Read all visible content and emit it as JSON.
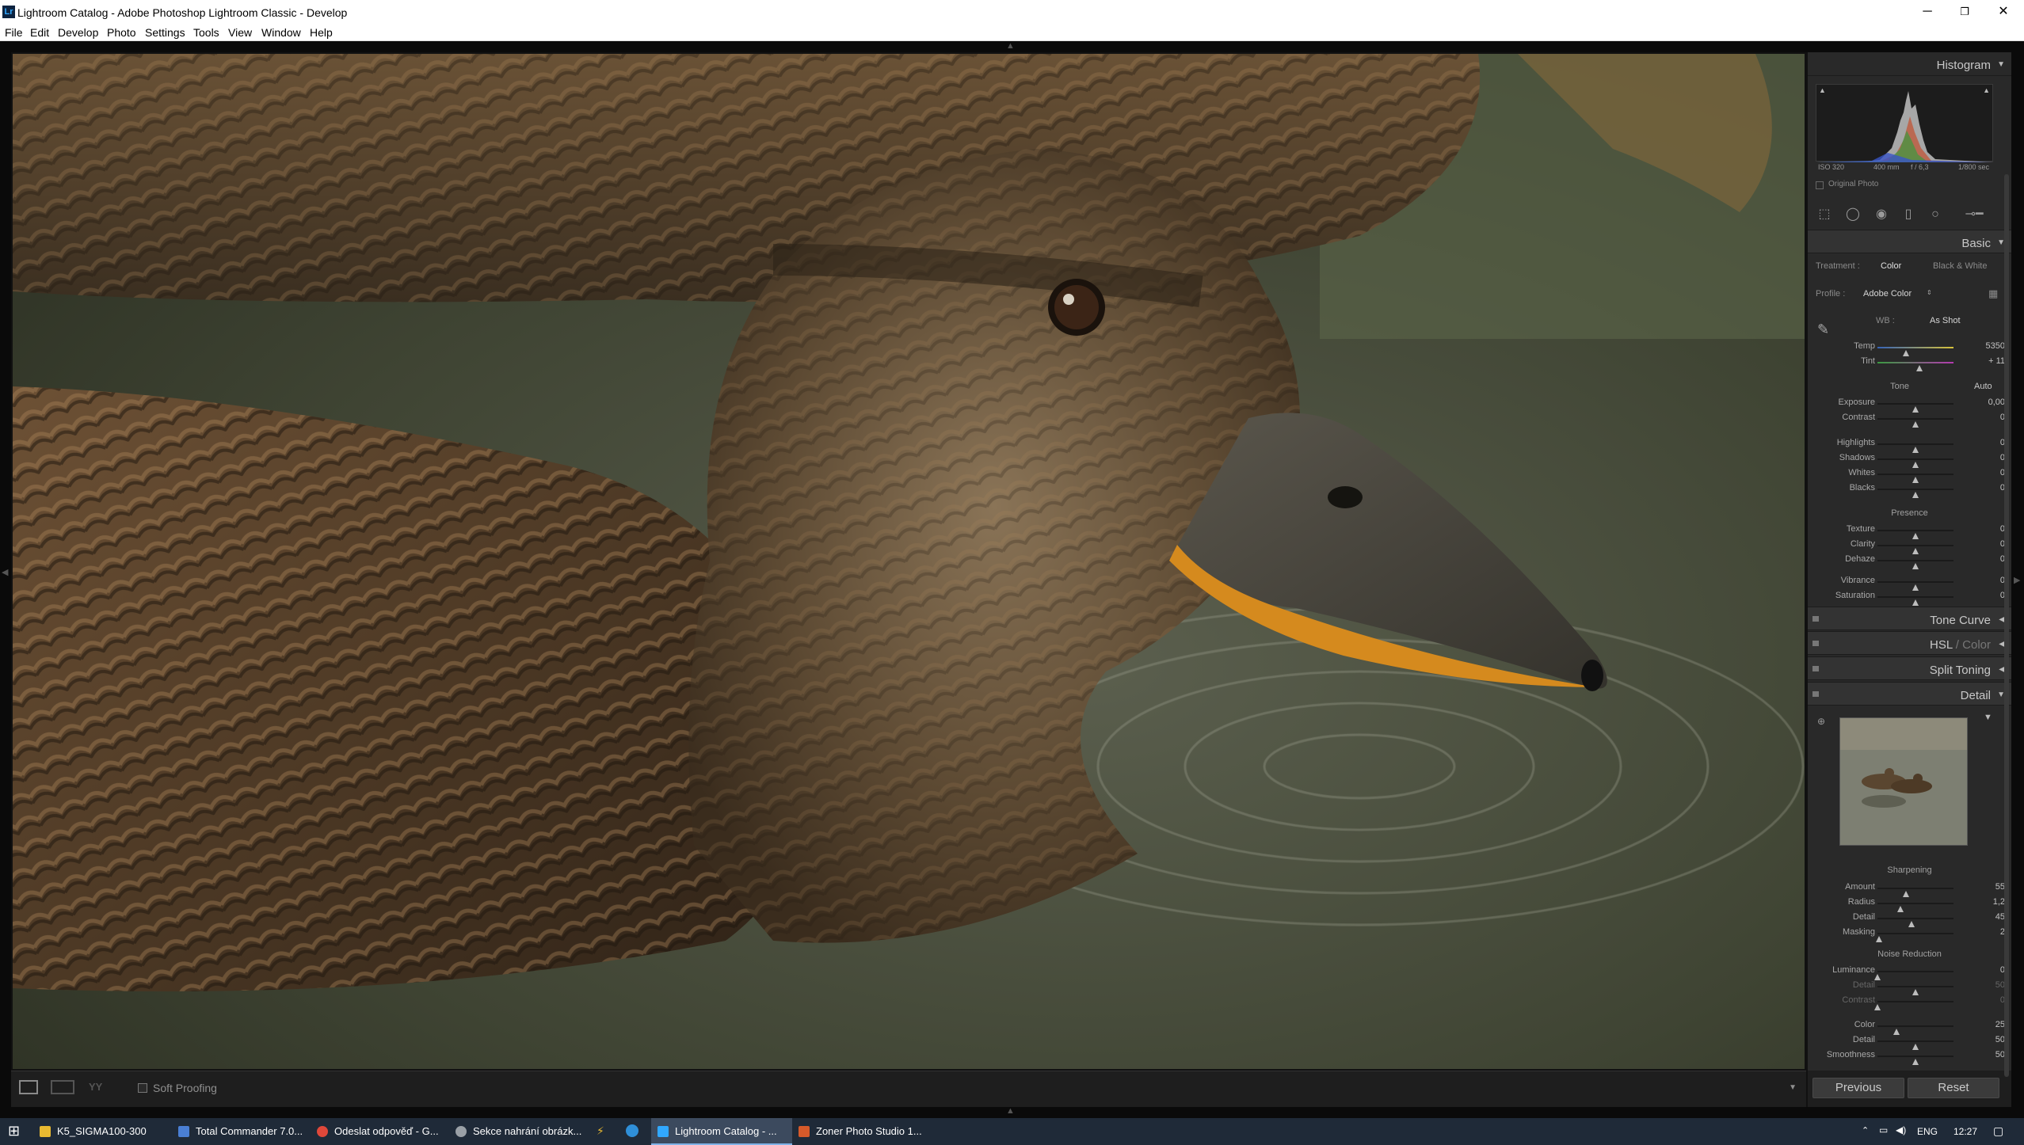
{
  "window": {
    "title": "Lightroom Catalog - Adobe Photoshop Lightroom Classic - Develop",
    "app_icon": "Lr"
  },
  "window_controls": {
    "minimize": "─",
    "maximize": "❐",
    "close": "✕"
  },
  "menu": [
    "File",
    "Edit",
    "Develop",
    "Photo",
    "Settings",
    "Tools",
    "View",
    "Window",
    "Help"
  ],
  "histogram": {
    "title": "Histogram",
    "iso": "ISO 320",
    "focal": "400 mm",
    "aperture": "f / 6,3",
    "shutter": "1/800 sec",
    "original_photo": "Original Photo"
  },
  "basic": {
    "title": "Basic",
    "treatment_label": "Treatment :",
    "treatment_color": "Color",
    "treatment_bw": "Black & White",
    "profile_label": "Profile :",
    "profile_value": "Adobe Color",
    "wb_label": "WB :",
    "wb_value": "As Shot",
    "temp": {
      "label": "Temp",
      "value": "5350",
      "pos": 0.37
    },
    "tint": {
      "label": "Tint",
      "value": "+ 11",
      "pos": 0.55
    },
    "tone_label": "Tone",
    "auto_label": "Auto",
    "tone_sliders": [
      {
        "label": "Exposure",
        "value": "0,00",
        "pos": 0.5
      },
      {
        "label": "Contrast",
        "value": "0",
        "pos": 0.5
      },
      {
        "label": "Highlights",
        "value": "0",
        "pos": 0.5
      },
      {
        "label": "Shadows",
        "value": "0",
        "pos": 0.5
      },
      {
        "label": "Whites",
        "value": "0",
        "pos": 0.5
      },
      {
        "label": "Blacks",
        "value": "0",
        "pos": 0.5
      }
    ],
    "presence_label": "Presence",
    "presence_sliders": [
      {
        "label": "Texture",
        "value": "0",
        "pos": 0.5
      },
      {
        "label": "Clarity",
        "value": "0",
        "pos": 0.5
      },
      {
        "label": "Dehaze",
        "value": "0",
        "pos": 0.5
      },
      {
        "label": "Vibrance",
        "value": "0",
        "pos": 0.5
      },
      {
        "label": "Saturation",
        "value": "0",
        "pos": 0.5
      }
    ]
  },
  "panels": {
    "tone_curve": "Tone Curve",
    "hsl": "HSL",
    "hsl_sep": "/",
    "color": "Color",
    "split_toning": "Split Toning",
    "detail": "Detail"
  },
  "detail": {
    "sharpening_label": "Sharpening",
    "sharpening": [
      {
        "label": "Amount",
        "value": "55",
        "pos": 0.37
      },
      {
        "label": "Radius",
        "value": "1,2",
        "pos": 0.3
      },
      {
        "label": "Detail",
        "value": "45",
        "pos": 0.45
      },
      {
        "label": "Masking",
        "value": "2",
        "pos": 0.02
      }
    ],
    "noise_label": "Noise Reduction",
    "noise": [
      {
        "label": "Luminance",
        "value": "0",
        "pos": 0.0
      },
      {
        "label": "Detail",
        "value": "50",
        "pos": 0.5
      },
      {
        "label": "Contrast",
        "value": "0",
        "pos": 0.0
      },
      {
        "label": "Color",
        "value": "25",
        "pos": 0.25
      },
      {
        "label": "Detail",
        "value": "50",
        "pos": 0.5
      },
      {
        "label": "Smoothness",
        "value": "50",
        "pos": 0.5
      }
    ]
  },
  "buttons": {
    "previous": "Previous",
    "reset": "Reset"
  },
  "toolbar": {
    "soft_proofing": "Soft Proofing",
    "before_after": "YY"
  },
  "taskbar": {
    "items": [
      {
        "label": "K5_SIGMA100-300",
        "color": "#e8b931"
      },
      {
        "label": "Total Commander 7.0...",
        "color": "#4a7fd4"
      },
      {
        "label": "Odeslat odpověď - G...",
        "color": "#e0483a"
      },
      {
        "label": "Sekce nahrání obrázk...",
        "color": "#9aa0a6"
      },
      {
        "label": "Lightroom Catalog - ...",
        "color": "#31a8ff"
      },
      {
        "label": "Zoner Photo Studio 1...",
        "color": "#d65a2a"
      }
    ],
    "lang": "ENG",
    "time": "12:27"
  }
}
